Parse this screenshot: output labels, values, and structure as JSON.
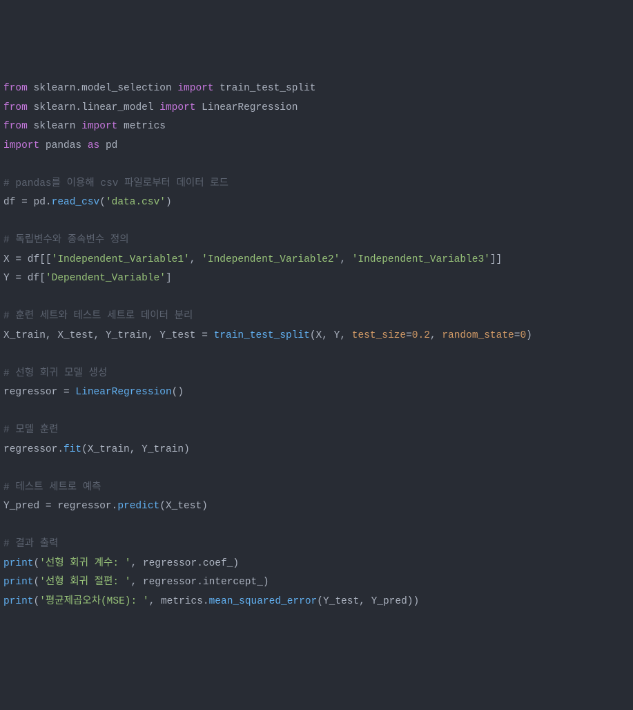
{
  "code": {
    "lines": [
      {
        "tokens": [
          {
            "t": "from ",
            "c": "kw"
          },
          {
            "t": "sklearn.model_selection ",
            "c": "id"
          },
          {
            "t": "import ",
            "c": "kw"
          },
          {
            "t": "train_test_split",
            "c": "id"
          }
        ]
      },
      {
        "tokens": [
          {
            "t": "from ",
            "c": "kw"
          },
          {
            "t": "sklearn.linear_model ",
            "c": "id"
          },
          {
            "t": "import ",
            "c": "kw"
          },
          {
            "t": "LinearRegression",
            "c": "id"
          }
        ]
      },
      {
        "tokens": [
          {
            "t": "from ",
            "c": "kw"
          },
          {
            "t": "sklearn ",
            "c": "id"
          },
          {
            "t": "import ",
            "c": "kw"
          },
          {
            "t": "metrics",
            "c": "id"
          }
        ]
      },
      {
        "tokens": [
          {
            "t": "import ",
            "c": "kw"
          },
          {
            "t": "pandas ",
            "c": "id"
          },
          {
            "t": "as ",
            "c": "kw"
          },
          {
            "t": "pd",
            "c": "id"
          }
        ]
      },
      {
        "tokens": []
      },
      {
        "tokens": [
          {
            "t": "# pandas를 이용해 csv 파일로부터 데이터 로드",
            "c": "cmt"
          }
        ]
      },
      {
        "tokens": [
          {
            "t": "df = pd.",
            "c": "id"
          },
          {
            "t": "read_csv",
            "c": "call"
          },
          {
            "t": "(",
            "c": "id"
          },
          {
            "t": "'data.csv'",
            "c": "str"
          },
          {
            "t": ")",
            "c": "id"
          }
        ]
      },
      {
        "tokens": []
      },
      {
        "tokens": [
          {
            "t": "# 독립변수와 종속변수 정의",
            "c": "cmt"
          }
        ]
      },
      {
        "tokens": [
          {
            "t": "X = df[[",
            "c": "id"
          },
          {
            "t": "'Independent_Variable1'",
            "c": "str"
          },
          {
            "t": ", ",
            "c": "id"
          },
          {
            "t": "'Independent_Variable2'",
            "c": "str"
          },
          {
            "t": ", ",
            "c": "id"
          },
          {
            "t": "'Independent_Variable3'",
            "c": "str"
          },
          {
            "t": "]]",
            "c": "id"
          }
        ]
      },
      {
        "tokens": [
          {
            "t": "Y = df[",
            "c": "id"
          },
          {
            "t": "'Dependent_Variable'",
            "c": "str"
          },
          {
            "t": "]",
            "c": "id"
          }
        ]
      },
      {
        "tokens": []
      },
      {
        "tokens": [
          {
            "t": "# 훈련 세트와 테스트 세트로 데이터 분리",
            "c": "cmt"
          }
        ]
      },
      {
        "tokens": [
          {
            "t": "X_train",
            "c": "id"
          },
          {
            "t": ", ",
            "c": "id"
          },
          {
            "t": "X_test",
            "c": "id"
          },
          {
            "t": ", ",
            "c": "id"
          },
          {
            "t": "Y_train",
            "c": "id"
          },
          {
            "t": ", ",
            "c": "id"
          },
          {
            "t": "Y_test = ",
            "c": "id"
          },
          {
            "t": "train_test_split",
            "c": "call"
          },
          {
            "t": "(X",
            "c": "id"
          },
          {
            "t": ", ",
            "c": "id"
          },
          {
            "t": "Y",
            "c": "id"
          },
          {
            "t": ", ",
            "c": "id"
          },
          {
            "t": "test_size",
            "c": "param"
          },
          {
            "t": "=",
            "c": "id"
          },
          {
            "t": "0.2",
            "c": "num"
          },
          {
            "t": ", ",
            "c": "id"
          },
          {
            "t": "random_state",
            "c": "param"
          },
          {
            "t": "=",
            "c": "id"
          },
          {
            "t": "0",
            "c": "num"
          },
          {
            "t": ")",
            "c": "id"
          }
        ]
      },
      {
        "tokens": []
      },
      {
        "tokens": [
          {
            "t": "# 선형 회귀 모델 생성",
            "c": "cmt"
          }
        ]
      },
      {
        "tokens": [
          {
            "t": "regressor = ",
            "c": "id"
          },
          {
            "t": "LinearRegression",
            "c": "call"
          },
          {
            "t": "()",
            "c": "id"
          }
        ]
      },
      {
        "tokens": []
      },
      {
        "tokens": [
          {
            "t": "# 모델 훈련",
            "c": "cmt"
          }
        ]
      },
      {
        "tokens": [
          {
            "t": "regressor.",
            "c": "id"
          },
          {
            "t": "fit",
            "c": "call"
          },
          {
            "t": "(X_train",
            "c": "id"
          },
          {
            "t": ", ",
            "c": "id"
          },
          {
            "t": "Y_train)",
            "c": "id"
          }
        ]
      },
      {
        "tokens": []
      },
      {
        "tokens": [
          {
            "t": "# 테스트 세트로 예측",
            "c": "cmt"
          }
        ]
      },
      {
        "tokens": [
          {
            "t": "Y_pred = regressor.",
            "c": "id"
          },
          {
            "t": "predict",
            "c": "call"
          },
          {
            "t": "(X_test)",
            "c": "id"
          }
        ]
      },
      {
        "tokens": []
      },
      {
        "tokens": [
          {
            "t": "# 결과 출력",
            "c": "cmt"
          }
        ]
      },
      {
        "tokens": [
          {
            "t": "print",
            "c": "call"
          },
          {
            "t": "(",
            "c": "id"
          },
          {
            "t": "'선형 회귀 계수: '",
            "c": "str"
          },
          {
            "t": ", ",
            "c": "id"
          },
          {
            "t": "regressor.coef_)",
            "c": "id"
          }
        ]
      },
      {
        "tokens": [
          {
            "t": "print",
            "c": "call"
          },
          {
            "t": "(",
            "c": "id"
          },
          {
            "t": "'선형 회귀 절편: '",
            "c": "str"
          },
          {
            "t": ", ",
            "c": "id"
          },
          {
            "t": "regressor.intercept_)",
            "c": "id"
          }
        ]
      },
      {
        "tokens": [
          {
            "t": "print",
            "c": "call"
          },
          {
            "t": "(",
            "c": "id"
          },
          {
            "t": "'평균제곱오차(MSE): '",
            "c": "str"
          },
          {
            "t": ", ",
            "c": "id"
          },
          {
            "t": "metrics.",
            "c": "id"
          },
          {
            "t": "mean_squared_error",
            "c": "call"
          },
          {
            "t": "(Y_test",
            "c": "id"
          },
          {
            "t": ", ",
            "c": "id"
          },
          {
            "t": "Y_pred))",
            "c": "id"
          }
        ]
      }
    ]
  }
}
